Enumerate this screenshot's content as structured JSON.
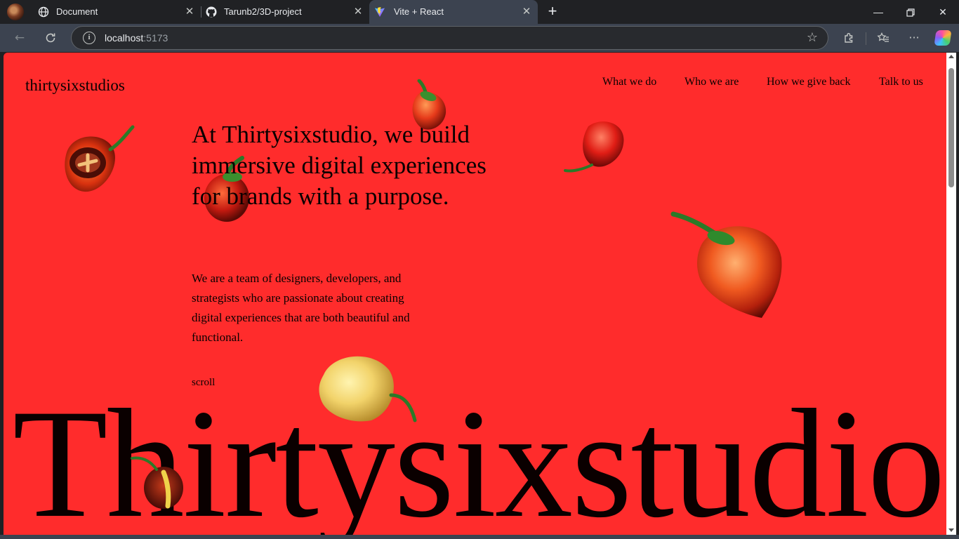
{
  "browser": {
    "tabs": [
      {
        "title": "Document",
        "icon": "globe-icon"
      },
      {
        "title": "Tarunb2/3D-project",
        "icon": "github-icon"
      },
      {
        "title": "Vite + React",
        "icon": "vite-icon",
        "active": true
      }
    ],
    "address": {
      "host": "localhost",
      "port": ":5173"
    },
    "colors": {
      "frame": "#202124",
      "toolbar": "#3c4350"
    }
  },
  "site": {
    "logo": "thirtysixstudios",
    "nav": [
      "What we do",
      "Who we are",
      "How we give back",
      "Talk to us"
    ],
    "headline": "At Thirtysixstudio, we build immersive digital experiences for brands with a purpose.",
    "intro": "We are a team of designers, developers, and strategists who are passionate about creating digital experiences that are both beautiful and functional.",
    "scroll_label": "scroll",
    "giant_title": "Thirtysixstudios",
    "background_color": "#ff2c2c"
  }
}
